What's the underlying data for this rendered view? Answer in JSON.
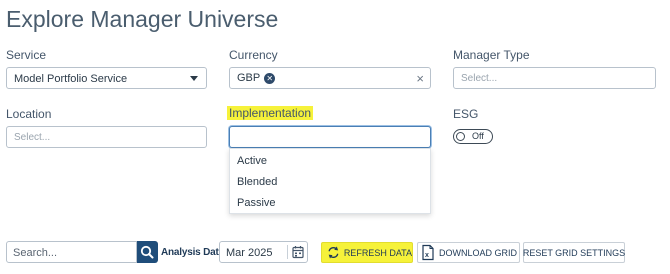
{
  "page": {
    "title": "Explore Manager Universe"
  },
  "filters": {
    "service": {
      "label": "Service",
      "value": "Model Portfolio Service"
    },
    "currency": {
      "label": "Currency",
      "chip": "GBP"
    },
    "manager_type": {
      "label": "Manager Type",
      "placeholder": "Select..."
    },
    "location": {
      "label": "Location",
      "placeholder": "Select..."
    },
    "implementation": {
      "label": "Implementation",
      "value": "",
      "options": [
        "Active",
        "Blended",
        "Passive"
      ]
    },
    "esg": {
      "label": "ESG",
      "toggle_label": "Off"
    }
  },
  "toolbar": {
    "search_placeholder": "Search...",
    "analysis_date_label": "Analysis Date",
    "analysis_date_value": "Mar 2025",
    "refresh_label": "REFRESH DATA",
    "download_label": "DOWNLOAD GRID",
    "reset_label": "RESET GRID SETTINGS"
  },
  "colors": {
    "highlight": "#f6f23a",
    "primary": "#1f4d7a",
    "chip": "#2e4a6a"
  },
  "icons": [
    "caret-down-icon",
    "chip-remove-icon",
    "clear-icon",
    "search-icon",
    "calendar-icon",
    "refresh-icon",
    "excel-icon"
  ]
}
